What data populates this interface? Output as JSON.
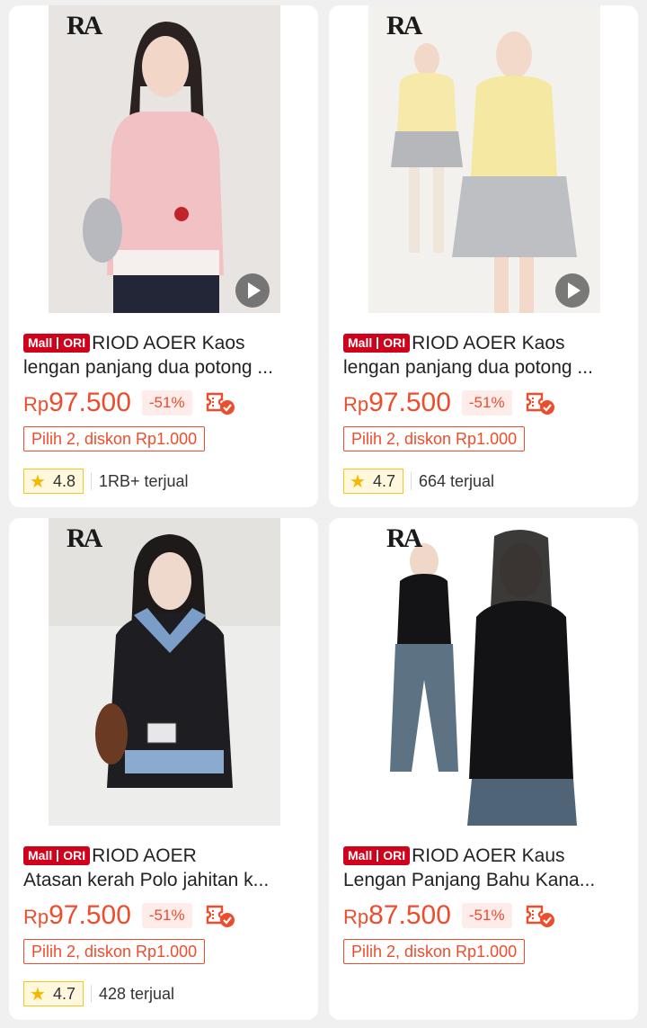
{
  "products": [
    {
      "logo": "RA",
      "badge": {
        "mall": "Mall",
        "ori": "ORI"
      },
      "title_line1": "RIOD AOER Kaos",
      "title_line2": "lengan panjang dua potong ...",
      "currency": "Rp",
      "price": "97.500",
      "discount": "-51%",
      "promo": "Pilih 2, diskon Rp1.000",
      "rating": "4.8",
      "sold": "1RB+ terjual",
      "has_video": true
    },
    {
      "logo": "RA",
      "badge": {
        "mall": "Mall",
        "ori": "ORI"
      },
      "title_line1": "RIOD AOER  Kaos",
      "title_line2": "lengan panjang dua potong ...",
      "currency": "Rp",
      "price": "97.500",
      "discount": "-51%",
      "promo": "Pilih 2, diskon Rp1.000",
      "rating": "4.7",
      "sold": "664 terjual",
      "has_video": true
    },
    {
      "logo": "RA",
      "badge": {
        "mall": "Mall",
        "ori": "ORI"
      },
      "title_line1": "RIOD AOER",
      "title_line2": "Atasan kerah Polo jahitan k...",
      "currency": "Rp",
      "price": "97.500",
      "discount": "-51%",
      "promo": "Pilih 2, diskon Rp1.000",
      "rating": "4.7",
      "sold": "428 terjual",
      "has_video": false
    },
    {
      "logo": "RA",
      "badge": {
        "mall": "Mall",
        "ori": "ORI"
      },
      "title_line1": "RIOD AOER Kaus",
      "title_line2": "Lengan Panjang Bahu Kana...",
      "currency": "Rp",
      "price": "87.500",
      "discount": "-51%",
      "promo": "Pilih 2, diskon Rp1.000",
      "has_video": false
    }
  ],
  "icons": {
    "play": "play-icon",
    "voucher": "voucher-check-icon",
    "star": "star-icon"
  },
  "colors": {
    "accent": "#ee4d2d",
    "mall_badge": "#d0011b",
    "rating_border": "#f3c622"
  }
}
